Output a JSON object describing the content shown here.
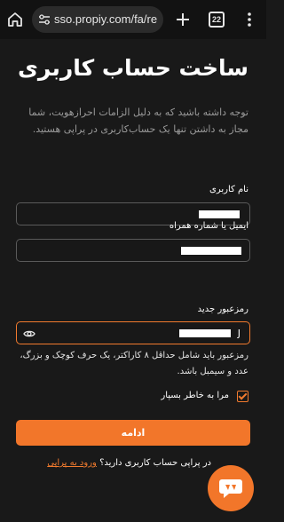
{
  "browser": {
    "url": "sso.propiy.com/fa/re",
    "tab_count": "22"
  },
  "page": {
    "title": "ساخت حساب کاربری",
    "intro": "توجه داشته باشید که به دلیل الزامات احرازهویت، شما مجاز به داشتن تنها یک حساب‌کاربری در پراپی هستید."
  },
  "form": {
    "username_label": "نام کاربری",
    "contact_label": "ایمیل یا شماره همراه",
    "password_label": "رمزعبور جدید",
    "password_leading_char": "J",
    "password_hint": "رمزعبور باید شامل حداقل ۸ کاراکتر، یک حرف کوچک و بزرگ، عدد و سیمبل باشد.",
    "remember_label": "مرا به خاطر بسپار",
    "remember_checked": true,
    "submit_label": "ادامه"
  },
  "footer": {
    "prompt": "در پراپی حساب کاربری دارید؟",
    "login_link": "ورود به پراپی"
  },
  "colors": {
    "accent": "#f2762a",
    "background": "#191919"
  }
}
